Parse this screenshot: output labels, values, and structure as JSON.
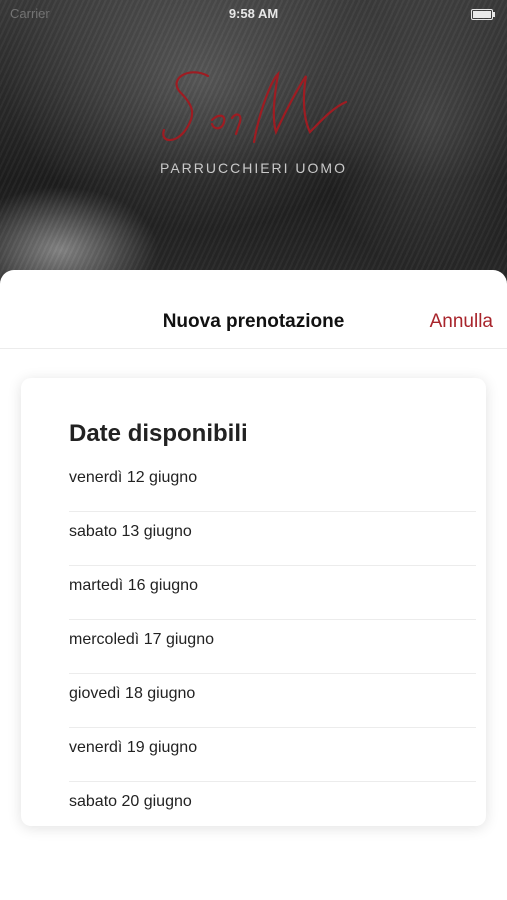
{
  "status_bar": {
    "carrier": "Carrier",
    "time": "9:58 AM"
  },
  "brand": {
    "monogram": "SeM",
    "subtitle": "PARRUCCHIERI UOMO"
  },
  "sheet": {
    "title": "Nuova prenotazione",
    "cancel_label": "Annulla",
    "accent_color": "#a8242b"
  },
  "dates": {
    "heading": "Date disponibili",
    "items": [
      "venerdì 12 giugno",
      "sabato 13 giugno",
      "martedì 16 giugno",
      "mercoledì 17 giugno",
      "giovedì 18 giugno",
      "venerdì 19 giugno",
      "sabato 20 giugno"
    ]
  }
}
